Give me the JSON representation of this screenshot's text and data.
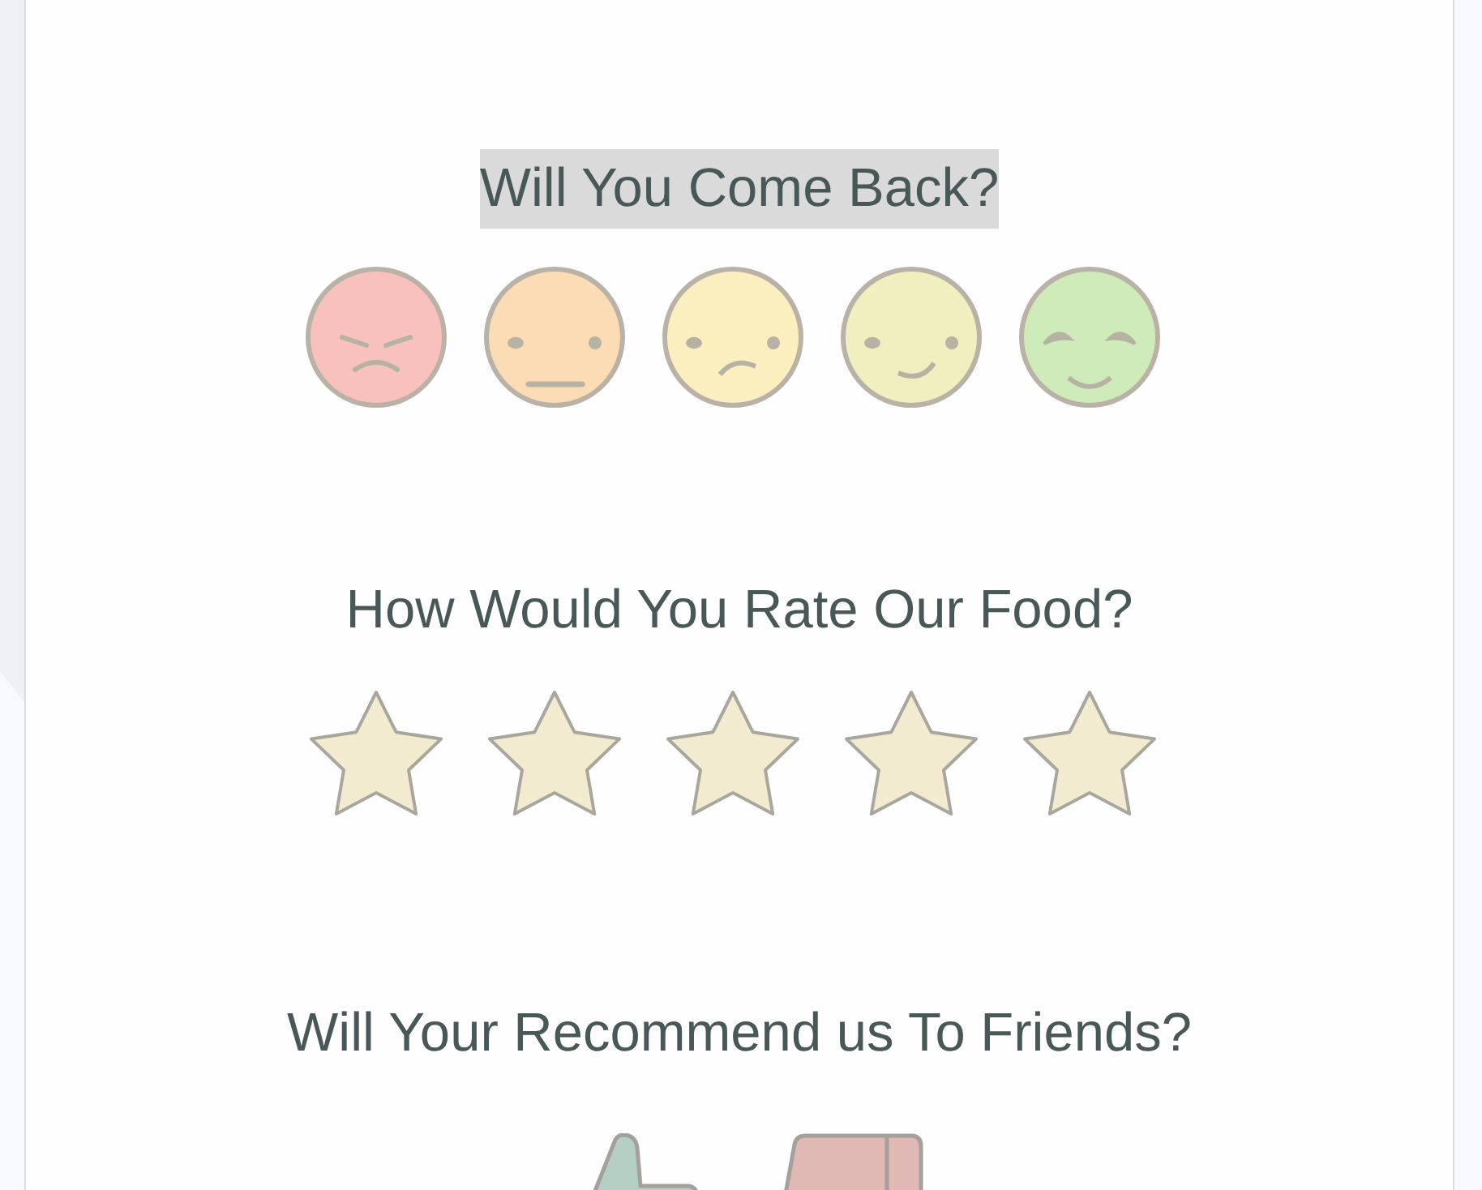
{
  "questions": [
    {
      "kind": "faces",
      "title": "Will You Come Back?",
      "highlighted": true,
      "options": [
        {
          "kind": "angry",
          "color": "#f9c1be",
          "selected": false
        },
        {
          "kind": "neutral",
          "color": "#fbdcb5",
          "selected": false
        },
        {
          "kind": "uneasy",
          "color": "#fbefc0",
          "selected": false
        },
        {
          "kind": "smile",
          "color": "#f0efc0",
          "selected": false
        },
        {
          "kind": "grin",
          "color": "#cfebb9",
          "selected": false
        }
      ]
    },
    {
      "kind": "stars",
      "title": "How Would You Rate Our Food?",
      "highlighted": false
    },
    {
      "kind": "thumbs",
      "title": "Will Your Recommend us To Friends?",
      "highlighted": false,
      "options": [
        {
          "kind": "up",
          "color": "#b5cfc4",
          "selected": false
        },
        {
          "kind": "down",
          "color": "#e0b9b5",
          "selected": false
        }
      ]
    }
  ]
}
